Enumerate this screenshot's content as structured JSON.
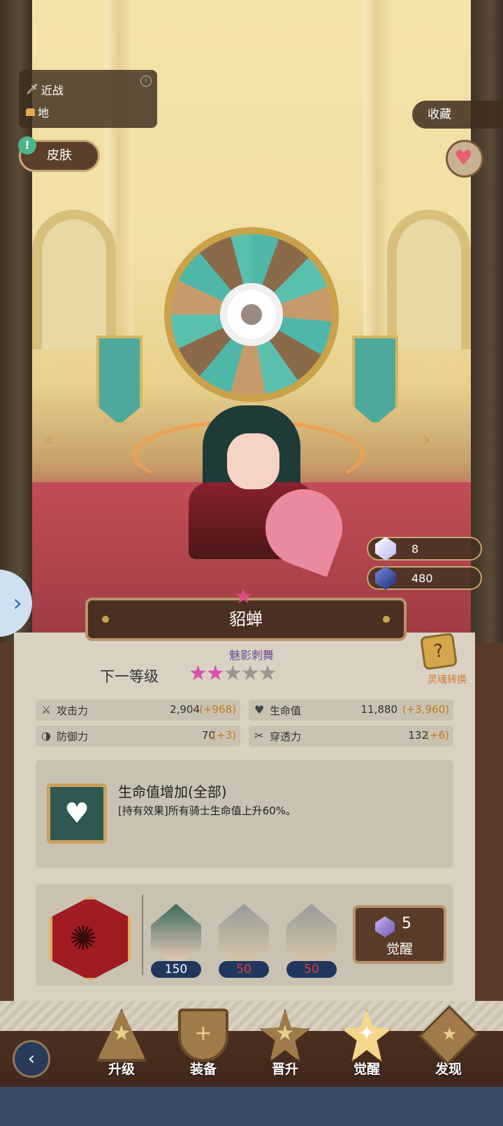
{
  "scene": {
    "attack_type": "近战",
    "terrain": "地",
    "info_icon": "info-icon",
    "skin_label": "皮肤",
    "collect_label": "收藏",
    "heart_icon": "♥"
  },
  "currency": [
    {
      "name": "crystal",
      "value": "8",
      "color": "#d8d4ff"
    },
    {
      "name": "dark-gem",
      "value": "480",
      "color": "#3a4aa0"
    }
  ],
  "hero": {
    "name": "貂蝉",
    "subtitle": "魅影刺舞",
    "next_level_label": "下一等级",
    "stars_filled": 2,
    "stars_total": 5,
    "soul_transfer_label": "灵魂转换"
  },
  "stats": [
    {
      "label": "攻击力",
      "value": "2,904",
      "bonus": "(+968)",
      "icon": "⚔"
    },
    {
      "label": "生命值",
      "value": "11,880",
      "bonus": "(+3,960)",
      "icon": "♥"
    },
    {
      "label": "防御力",
      "value": "70",
      "bonus": "(+3)",
      "icon": "◑"
    },
    {
      "label": "穿透力",
      "value": "132",
      "bonus": "(+6)",
      "icon": "✂"
    }
  ],
  "effect": {
    "title": "生命值增加(全部)",
    "description": "[持有效果]所有骑士生命值上升60%。"
  },
  "awaken": {
    "materials": [
      {
        "count": "150",
        "count_color": "#ffffff"
      },
      {
        "count": "50",
        "count_color": "#e04040"
      },
      {
        "count": "50",
        "count_color": "#e04040"
      }
    ],
    "cost": "5",
    "button_label": "觉醒"
  },
  "nav": {
    "tabs": [
      {
        "label": "升级",
        "active": false
      },
      {
        "label": "装备",
        "active": false
      },
      {
        "label": "晋升",
        "active": false
      },
      {
        "label": "觉醒",
        "active": true
      },
      {
        "label": "发现",
        "active": false
      }
    ]
  },
  "colors": {
    "accent_gold": "#c9a24a",
    "star_pink": "#d74fb0",
    "bonus_orange": "#c07a1a",
    "panel_bg": "#d9d2c3"
  }
}
